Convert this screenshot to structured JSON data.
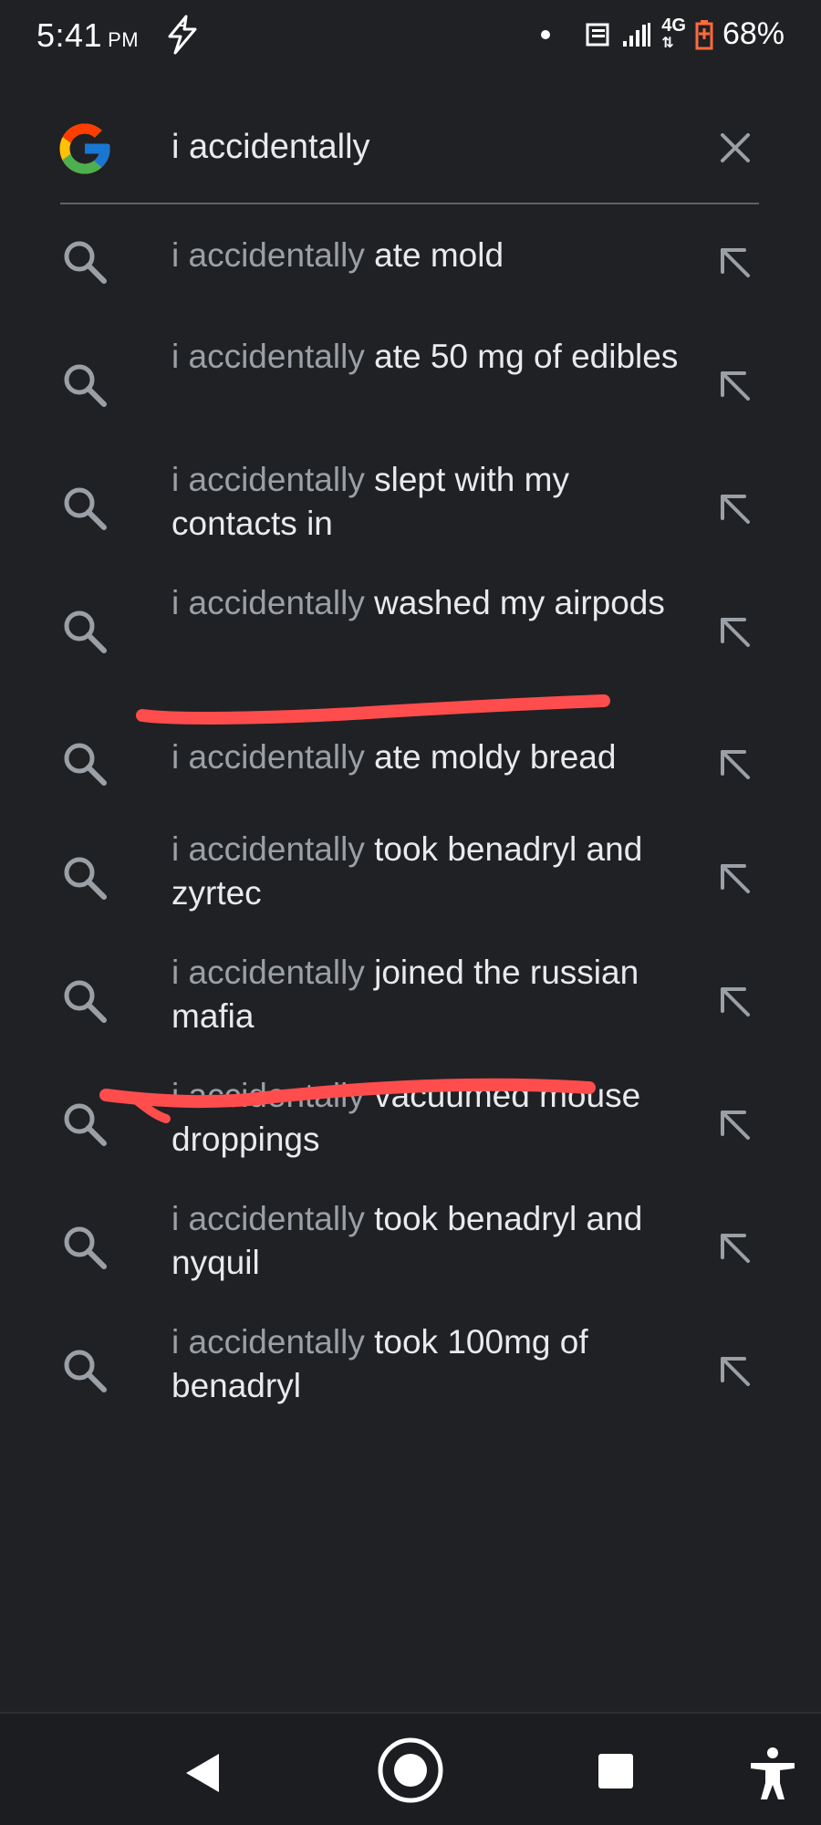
{
  "status_bar": {
    "time": "5:41",
    "ampm": "PM",
    "network": "4G",
    "battery": "68%"
  },
  "search": {
    "query": "i accidentally",
    "clear_icon": "close-icon",
    "logo": "google-logo"
  },
  "suggestions": [
    {
      "prefix": "i accidentally",
      "suffix": " ate mold"
    },
    {
      "prefix": "i accidentally",
      "suffix": " ate 50 mg of edibles"
    },
    {
      "prefix": "i accidentally",
      "suffix": " slept with my contacts in"
    },
    {
      "prefix": "i accidentally",
      "suffix": " washed my airpods"
    },
    {
      "prefix": "i accidentally",
      "suffix": " ate moldy bread"
    },
    {
      "prefix": "i accidentally",
      "suffix": " took benadryl and zyrtec"
    },
    {
      "prefix": "i accidentally",
      "suffix": " joined the russian mafia"
    },
    {
      "prefix": "i accidentally",
      "suffix": " vacuumed mouse droppings"
    },
    {
      "prefix": "i accidentally",
      "suffix": " took benadryl and nyquil"
    },
    {
      "prefix": "i accidentally",
      "suffix": " took 100mg of benadryl"
    }
  ],
  "icons": {
    "suggestion_left": "search-icon",
    "suggestion_right": "arrow-up-left-icon"
  },
  "colors": {
    "background": "#202124",
    "prefix_text": "#9aa0a6",
    "suffix_text": "#e8eaed",
    "annotation": "#ff4d4d"
  },
  "nav_bar": {
    "back_icon": "back-triangle-icon",
    "home_icon": "home-circle-icon",
    "recents_icon": "recents-square-icon",
    "accessibility_icon": "accessibility-icon"
  }
}
